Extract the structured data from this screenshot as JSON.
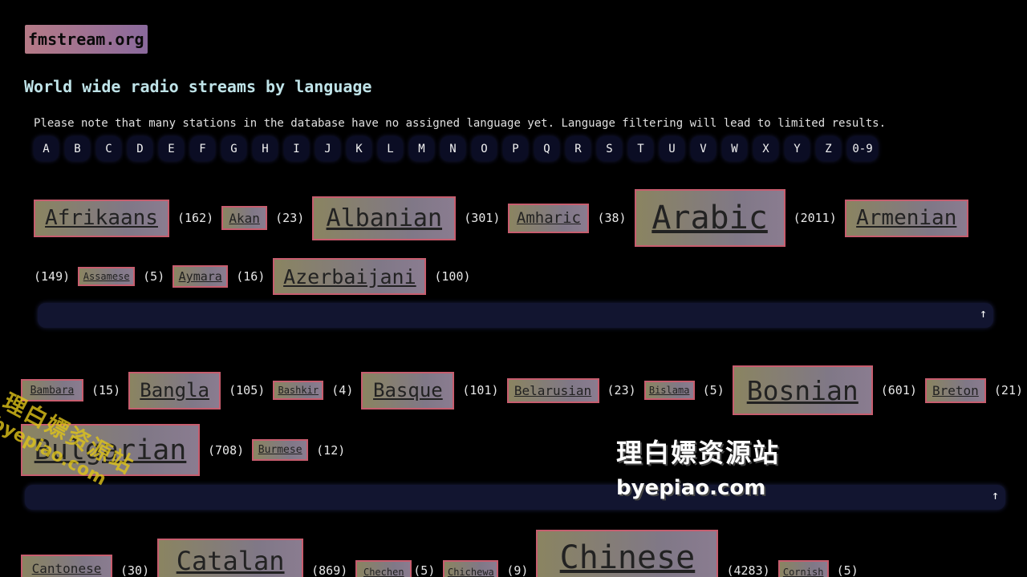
{
  "site": {
    "logo": "fmstream.org"
  },
  "heading": "World wide radio streams by language",
  "note": "Please note that many stations in the database have no assigned language yet. Language filtering will lead to limited results.",
  "alphabet": [
    "A",
    "B",
    "C",
    "D",
    "E",
    "F",
    "G",
    "H",
    "I",
    "J",
    "K",
    "L",
    "M",
    "N",
    "O",
    "P",
    "Q",
    "R",
    "S",
    "T",
    "U",
    "V",
    "W",
    "X",
    "Y",
    "Z",
    "0-9"
  ],
  "up_arrow": "↑",
  "sections": {
    "A": [
      {
        "name": "Afrikaans",
        "count": "(162)"
      },
      {
        "name": "Akan",
        "count": "(23)"
      },
      {
        "name": "Albanian",
        "count": "(301)"
      },
      {
        "name": "Amharic",
        "count": "(38)"
      },
      {
        "name": "Arabic",
        "count": "(2011)"
      },
      {
        "name": "Armenian",
        "count": "(149)"
      },
      {
        "name": "Assamese",
        "count": "(5)"
      },
      {
        "name": "Aymara",
        "count": "(16)"
      },
      {
        "name": "Azerbaijani",
        "count": "(100)"
      }
    ],
    "B": [
      {
        "name": "Bambara",
        "count": "(15)"
      },
      {
        "name": "Bangla",
        "count": "(105)"
      },
      {
        "name": "Bashkir",
        "count": "(4)"
      },
      {
        "name": "Basque",
        "count": "(101)"
      },
      {
        "name": "Belarusian",
        "count": "(23)"
      },
      {
        "name": "Bislama",
        "count": "(5)"
      },
      {
        "name": "Bosnian",
        "count": "(601)"
      },
      {
        "name": "Breton",
        "count": "(21)"
      },
      {
        "name": "Bulgarian",
        "count": "(708)"
      },
      {
        "name": "Burmese",
        "count": "(12)"
      }
    ],
    "C": [
      {
        "name": "Cantonese",
        "count": "(30)"
      },
      {
        "name": "Catalan",
        "count": "(869)"
      },
      {
        "name": "Chechen",
        "count": "(5)"
      },
      {
        "name": "Chichewa",
        "count": "(9)"
      },
      {
        "name": "Chinese",
        "count": "(4283)"
      },
      {
        "name": "Cornish",
        "count": "(5)"
      }
    ]
  },
  "watermark": {
    "cn": "理白嫖资源站",
    "en": "byepiao.com"
  }
}
